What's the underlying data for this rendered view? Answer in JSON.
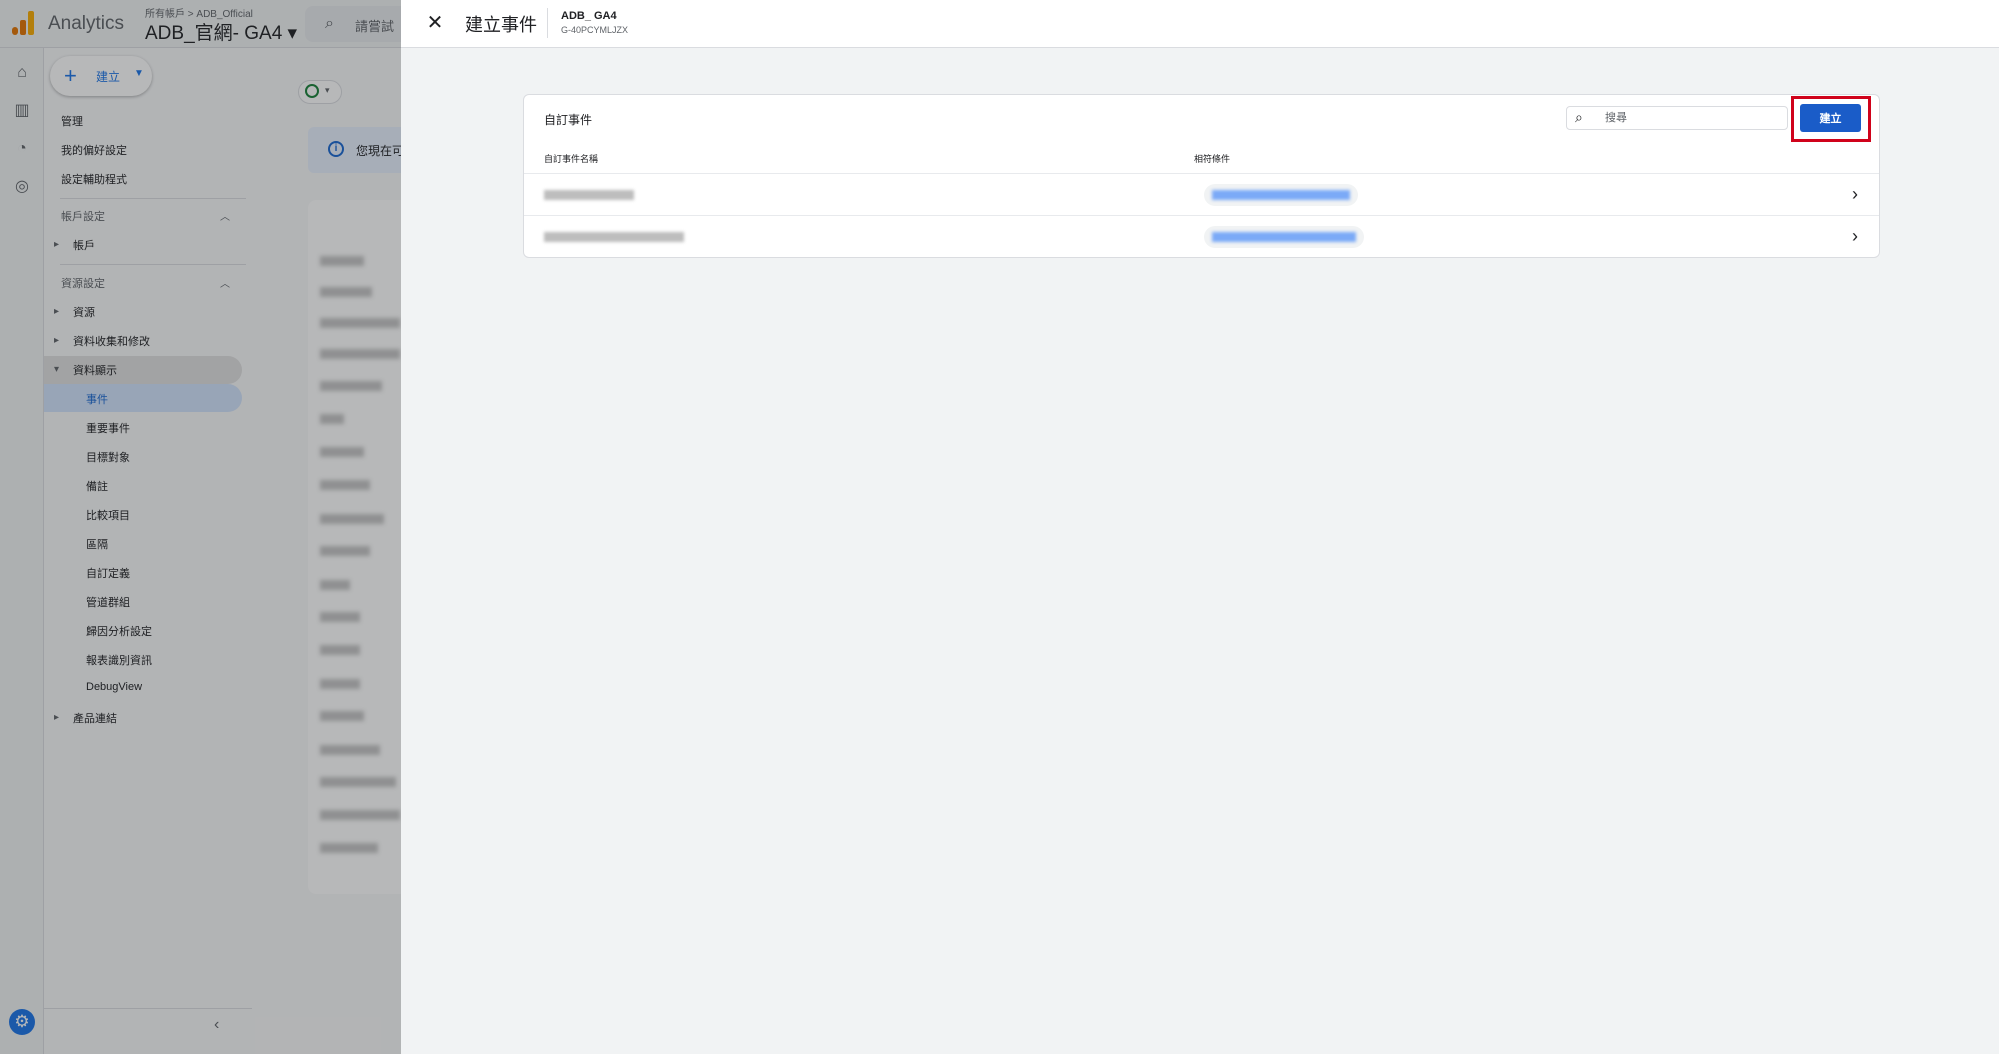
{
  "app": {
    "product_name": "Analytics",
    "breadcrumb": "所有帳戶 > ADB_Official",
    "property_name": "ADB_官網- GA4",
    "search_placeholder": "請嘗試"
  },
  "sidebar": {
    "create_label": "建立",
    "top_items": [
      "管理",
      "我的偏好設定",
      "設定輔助程式"
    ],
    "account_section": "帳戶設定",
    "account_items": [
      "帳戶"
    ],
    "property_section": "資源設定",
    "property_items": [
      "資源",
      "資料收集和修改",
      "資料顯示"
    ],
    "data_display_items": [
      "事件",
      "重要事件",
      "目標對象",
      "備註",
      "比較項目",
      "區隔",
      "自訂定義",
      "管道群組",
      "歸因分析設定",
      "報表識別資訊",
      "DebugView"
    ],
    "product_links": "產品連結"
  },
  "main": {
    "banner_text": "您現在可"
  },
  "panel": {
    "title": "建立事件",
    "property_title": "ADB_ GA4",
    "property_id": "G-40PCYMLJZX",
    "card": {
      "title": "自訂事件",
      "search_placeholder": "搜尋",
      "create_button": "建立",
      "columns": {
        "name": "自訂事件名稱",
        "condition": "相符條件"
      },
      "rows": [
        {
          "id": "row-1"
        },
        {
          "id": "row-2"
        }
      ]
    }
  },
  "colors": {
    "accent": "#1a73e8",
    "primary_button": "#1a5cc8",
    "highlight_box": "#d0021b"
  }
}
